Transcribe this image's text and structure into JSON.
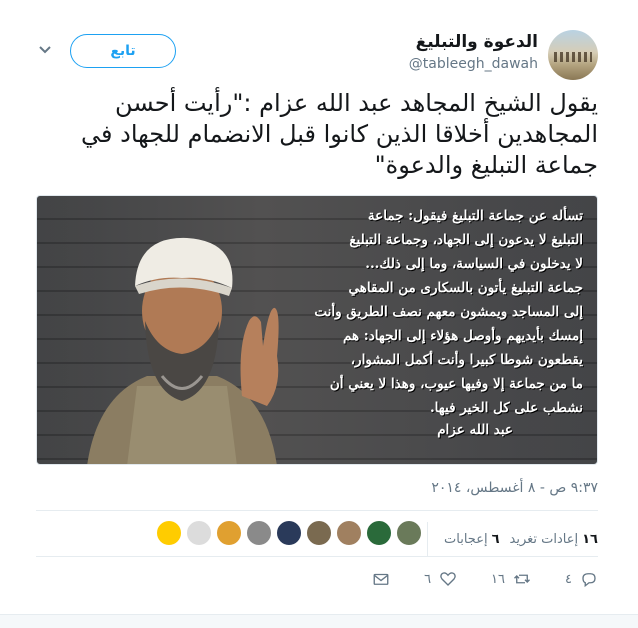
{
  "account": {
    "display_name": "الدعوة والتبليغ",
    "handle": "@tableegh_dawah"
  },
  "header": {
    "follow_label": "تابع"
  },
  "tweet": {
    "text": "يقول الشيخ المجاهد عبد الله عزام :\"رأيت أحسن المجاهدين أخلاقا الذين كانوا قبل الانضمام للجهاد في جماعة التبليغ والدعوة\"",
    "timestamp": "٩:٣٧ ص - ٨ أغسطس، ٢٠١٤"
  },
  "media": {
    "quote_lines": [
      "تسأله عن جماعة التبليغ فيقول: جماعة",
      "التبليغ لا يدعون إلى الجهاد، وجماعة التبليغ",
      "لا يدخلون في السياسة، وما إلى ذلك...",
      "جماعة التبليغ يأتون بالسكارى من المقاهي",
      "إلى المساجد ويمشون معهم نصف الطريق وأنت",
      "إمسك بأيديهم وأوصل هؤلاء إلى الجهاد: هم",
      "يقطعون شوطا كبيرا وأنت أكمل المشوار،",
      "ما من جماعة إلا وفيها عيوب، وهذا لا يعني أن",
      "نشطب على كل الخير فيها."
    ],
    "quote_author": "عبد الله عزام"
  },
  "stats": {
    "retweets_count": "١٦",
    "retweets_label": "إعادات تغريد",
    "likes_count": "٦",
    "likes_label": "إعجابات",
    "liker_colors": [
      "#ffcc00",
      "#dcdcdc",
      "#e0a030",
      "#8a8a8a",
      "#2a3a5a",
      "#7a6a50",
      "#a08060",
      "#2a6a3a",
      "#6a7a5a"
    ]
  },
  "actions": {
    "reply_count": "٤",
    "retweet_count": "١٦",
    "like_count": "٦"
  },
  "colors": {
    "accent": "#1da1f2",
    "muted": "#657786",
    "text": "#14171a"
  }
}
